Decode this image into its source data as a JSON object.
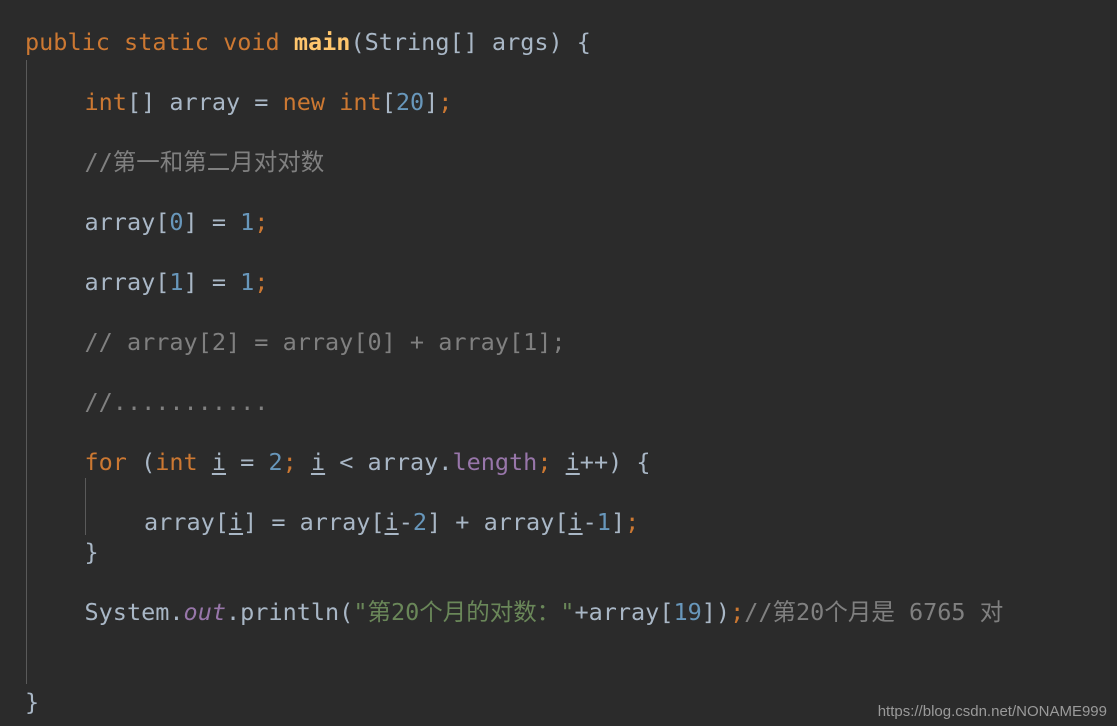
{
  "editor": {
    "theme_name": "Darcula",
    "language": "Java",
    "background_color": "#2b2b2b",
    "default_text_color": "#a9b7c6",
    "keyword_color": "#cc7832",
    "number_color": "#6897bb",
    "string_color": "#6a8759",
    "comment_color": "#808080",
    "method_color": "#ffc66d",
    "field_color": "#9876aa",
    "indent_guide_color": "#5a5a5a"
  },
  "code": {
    "lines": [
      {
        "index": 0,
        "indent": 0,
        "text": "public static void main(String[] args) {",
        "tokens": [
          {
            "t": "public",
            "c": "kw"
          },
          {
            "t": " ",
            "c": "plain"
          },
          {
            "t": "static",
            "c": "kw"
          },
          {
            "t": " ",
            "c": "plain"
          },
          {
            "t": "void",
            "c": "kw"
          },
          {
            "t": " ",
            "c": "plain"
          },
          {
            "t": "main",
            "c": "method"
          },
          {
            "t": "(String[] args) {",
            "c": "plain"
          }
        ]
      },
      {
        "index": 1,
        "indent": 1,
        "text": "int[] array = new int[20];",
        "tokens": [
          {
            "t": "int",
            "c": "kw"
          },
          {
            "t": "[] array = ",
            "c": "plain"
          },
          {
            "t": "new",
            "c": "kw"
          },
          {
            "t": " ",
            "c": "plain"
          },
          {
            "t": "int",
            "c": "kw"
          },
          {
            "t": "[",
            "c": "plain"
          },
          {
            "t": "20",
            "c": "num"
          },
          {
            "t": "]",
            "c": "plain"
          },
          {
            "t": ";",
            "c": "semi"
          }
        ]
      },
      {
        "index": 2,
        "indent": 1,
        "text": "//第一和第二月对对数",
        "tokens": [
          {
            "t": "//第一和第二月对对数",
            "c": "cmt"
          }
        ]
      },
      {
        "index": 3,
        "indent": 1,
        "text": "array[0] = 1;",
        "tokens": [
          {
            "t": "array[",
            "c": "plain"
          },
          {
            "t": "0",
            "c": "num"
          },
          {
            "t": "] = ",
            "c": "plain"
          },
          {
            "t": "1",
            "c": "num"
          },
          {
            "t": ";",
            "c": "semi"
          }
        ]
      },
      {
        "index": 4,
        "indent": 1,
        "text": "array[1] = 1;",
        "tokens": [
          {
            "t": "array[",
            "c": "plain"
          },
          {
            "t": "1",
            "c": "num"
          },
          {
            "t": "] = ",
            "c": "plain"
          },
          {
            "t": "1",
            "c": "num"
          },
          {
            "t": ";",
            "c": "semi"
          }
        ]
      },
      {
        "index": 5,
        "indent": 1,
        "text": "// array[2] = array[0] + array[1];",
        "tokens": [
          {
            "t": "// array[2] = array[0] + array[1];",
            "c": "cmt"
          }
        ]
      },
      {
        "index": 6,
        "indent": 1,
        "text": "//...........",
        "tokens": [
          {
            "t": "//...........",
            "c": "cmt"
          }
        ]
      },
      {
        "index": 7,
        "indent": 1,
        "text": "for (int i = 2; i < array.length; i++) {",
        "tokens": [
          {
            "t": "for",
            "c": "kw"
          },
          {
            "t": " (",
            "c": "plain"
          },
          {
            "t": "int",
            "c": "kw"
          },
          {
            "t": " ",
            "c": "plain"
          },
          {
            "t": "i",
            "c": "localvar"
          },
          {
            "t": " = ",
            "c": "plain"
          },
          {
            "t": "2",
            "c": "num"
          },
          {
            "t": ";",
            "c": "semi"
          },
          {
            "t": " ",
            "c": "plain"
          },
          {
            "t": "i",
            "c": "localvar"
          },
          {
            "t": " < array.",
            "c": "plain"
          },
          {
            "t": "length",
            "c": "prop"
          },
          {
            "t": ";",
            "c": "semi"
          },
          {
            "t": " ",
            "c": "plain"
          },
          {
            "t": "i",
            "c": "localvar"
          },
          {
            "t": "++) {",
            "c": "plain"
          }
        ]
      },
      {
        "index": 8,
        "indent": 2,
        "text": "array[i] = array[i-2] + array[i-1];",
        "tokens": [
          {
            "t": "array[",
            "c": "plain"
          },
          {
            "t": "i",
            "c": "localvar"
          },
          {
            "t": "] = array[",
            "c": "plain"
          },
          {
            "t": "i",
            "c": "localvar"
          },
          {
            "t": "-",
            "c": "plain"
          },
          {
            "t": "2",
            "c": "num"
          },
          {
            "t": "] + array[",
            "c": "plain"
          },
          {
            "t": "i",
            "c": "localvar"
          },
          {
            "t": "-",
            "c": "plain"
          },
          {
            "t": "1",
            "c": "num"
          },
          {
            "t": "]",
            "c": "plain"
          },
          {
            "t": ";",
            "c": "semi"
          }
        ]
      },
      {
        "index": 9,
        "indent": 1,
        "text": "}",
        "tokens": [
          {
            "t": "}",
            "c": "plain"
          }
        ]
      },
      {
        "index": 10,
        "indent": 1,
        "text": "System.out.println(\"第20个月的对数：\"+array[19]);//第20个月是 6765 对",
        "tokens": [
          {
            "t": "System.",
            "c": "plain"
          },
          {
            "t": "out",
            "c": "field"
          },
          {
            "t": ".println(",
            "c": "plain"
          },
          {
            "t": "\"第20个月的对数：\"",
            "c": "str"
          },
          {
            "t": "+array[",
            "c": "plain"
          },
          {
            "t": "19",
            "c": "num"
          },
          {
            "t": "])",
            "c": "plain"
          },
          {
            "t": ";",
            "c": "semi"
          },
          {
            "t": "//第20个月是 6765 对",
            "c": "cmt"
          }
        ]
      },
      {
        "index": 11,
        "indent": 0,
        "text": "}",
        "tokens": [
          {
            "t": "}",
            "c": "plain"
          }
        ]
      }
    ]
  },
  "watermark": {
    "text": "https://blog.csdn.net/NONAME999"
  }
}
